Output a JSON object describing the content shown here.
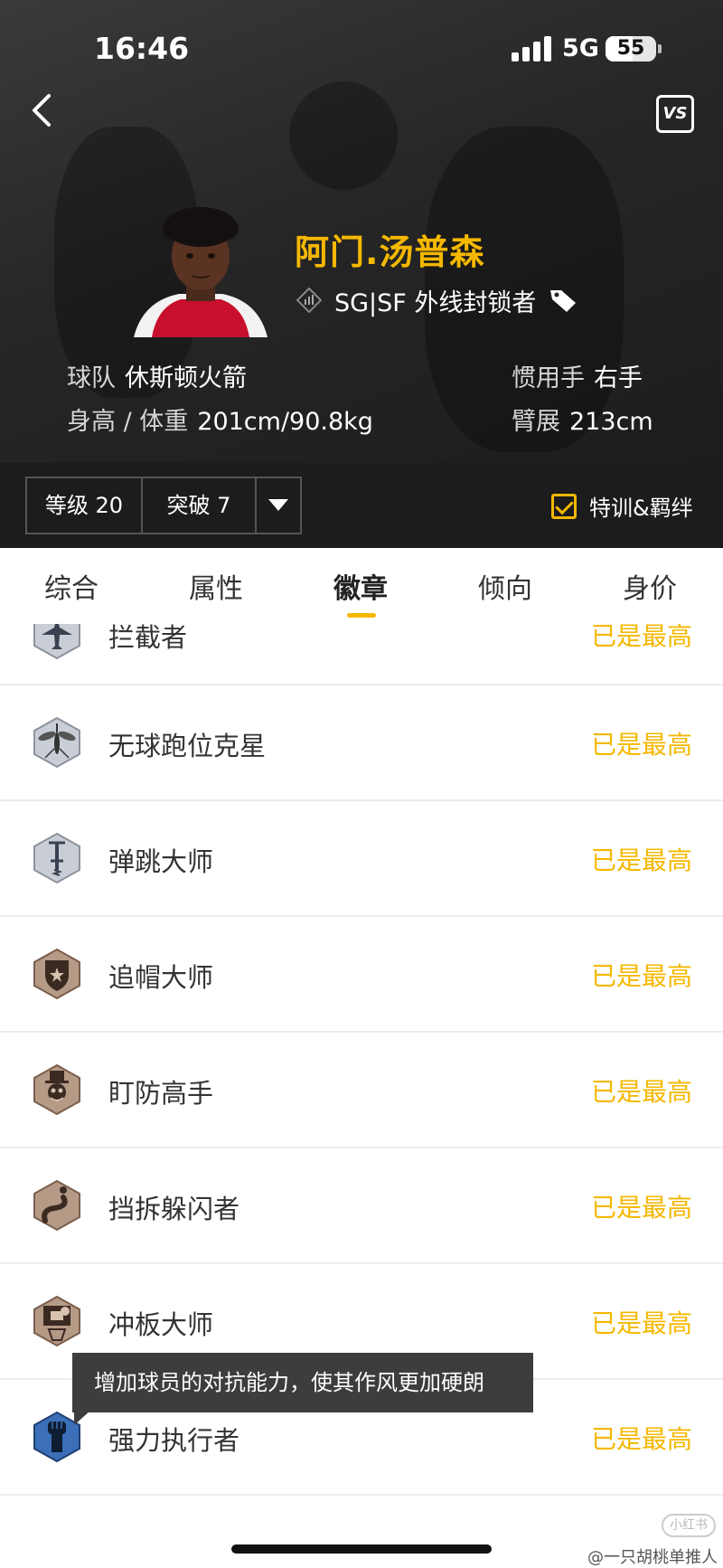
{
  "status_bar": {
    "time": "16:46",
    "network": "5G",
    "battery": "55"
  },
  "header": {
    "vs_label": "VS",
    "player_name": "阿门.汤普森",
    "positions": "SG|SF 外线封锁者",
    "team_label": "球队",
    "team_value": "休斯顿火箭",
    "body_label": "身高 / 体重",
    "body_value": "201cm/90.8kg",
    "hand_label": "惯用手",
    "hand_value": "右手",
    "wingspan_label": "臂展",
    "wingspan_value": "213cm"
  },
  "level_bar": {
    "level": "等级 20",
    "breakthrough": "突破 7",
    "training_label": "特训&羁绊",
    "training_checked": true
  },
  "tabs": [
    {
      "label": "综合",
      "active": false
    },
    {
      "label": "属性",
      "active": false
    },
    {
      "label": "徽章",
      "active": true
    },
    {
      "label": "倾向",
      "active": false
    },
    {
      "label": "身价",
      "active": false
    }
  ],
  "badges": [
    {
      "name": "拦截者",
      "status": "已是最高",
      "icon": "jet-icon",
      "tier": "silver"
    },
    {
      "name": "无球跑位克星",
      "status": "已是最高",
      "icon": "mosquito-icon",
      "tier": "silver"
    },
    {
      "name": "弹跳大师",
      "status": "已是最高",
      "icon": "pogo-stick-icon",
      "tier": "silver"
    },
    {
      "name": "追帽大师",
      "status": "已是最高",
      "icon": "shield-star-icon",
      "tier": "bronze"
    },
    {
      "name": "盯防高手",
      "status": "已是最高",
      "icon": "top-hat-face-icon",
      "tier": "bronze"
    },
    {
      "name": "挡拆躲闪者",
      "status": "已是最高",
      "icon": "road-pin-icon",
      "tier": "bronze"
    },
    {
      "name": "冲板大师",
      "status": "已是最高",
      "icon": "backboard-icon",
      "tier": "bronze"
    },
    {
      "name": "强力执行者",
      "status": "已是最高",
      "icon": "fist-icon",
      "tier": "blue"
    }
  ],
  "tooltip": "增加球员的对抗能力，使其作风更加硬朗",
  "watermark": "@一只胡桃单推人",
  "watermark_logo": "小红书",
  "colors": {
    "accent": "#f5b800",
    "header_bg": "#262626",
    "divider": "#ececec"
  }
}
